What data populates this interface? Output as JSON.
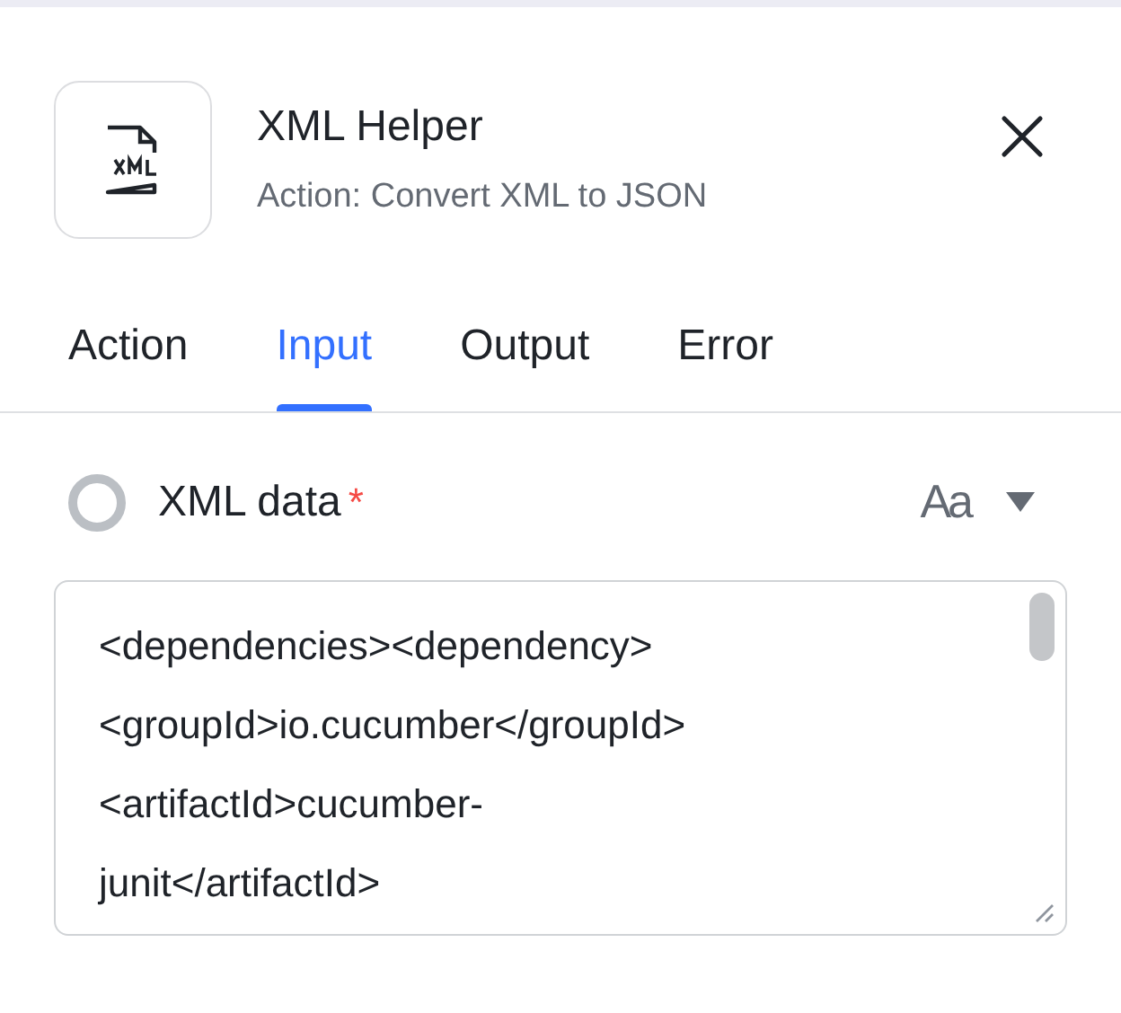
{
  "header": {
    "title": "XML Helper",
    "subtitle": "Action: Convert XML to JSON"
  },
  "tabs": [
    {
      "label": "Action",
      "selected": false
    },
    {
      "label": "Input",
      "selected": true
    },
    {
      "label": "Output",
      "selected": false
    },
    {
      "label": "Error",
      "selected": false
    }
  ],
  "field": {
    "label": "XML data",
    "required_mark": "*",
    "checked": false,
    "format_toggle": "Aa",
    "value_lines": [
      "<dependencies><dependency>",
      "<groupId>io.cucumber</groupId>",
      "<artifactId>cucumber-",
      "junit</artifactId>"
    ]
  }
}
